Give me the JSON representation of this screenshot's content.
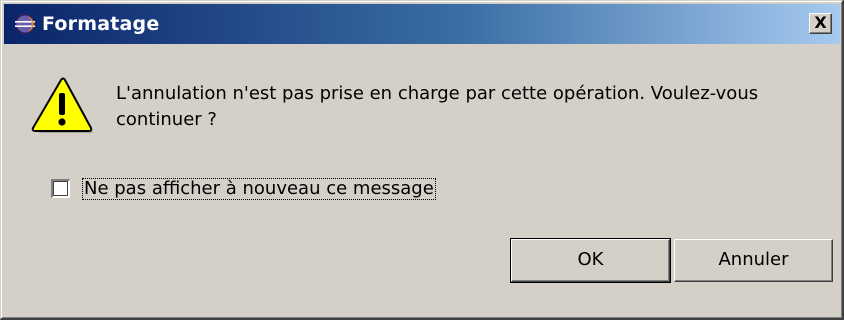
{
  "window": {
    "title": "Formatage",
    "close_label": "X",
    "icon": "eclipse-app-icon"
  },
  "dialog": {
    "icon": "warning-icon",
    "message": "L'annulation n'est pas prise en charge par cette opération. Voulez-vous continuer ?",
    "checkbox": {
      "label": "Ne pas afficher à nouveau ce message",
      "checked": false
    },
    "buttons": {
      "ok_label": "OK",
      "cancel_label": "Annuler"
    }
  },
  "colors": {
    "titlebar_start": "#0a246a",
    "titlebar_end": "#a6caf0",
    "dialog_bg": "#d4d0c8",
    "warning_yellow": "#ffff00"
  }
}
